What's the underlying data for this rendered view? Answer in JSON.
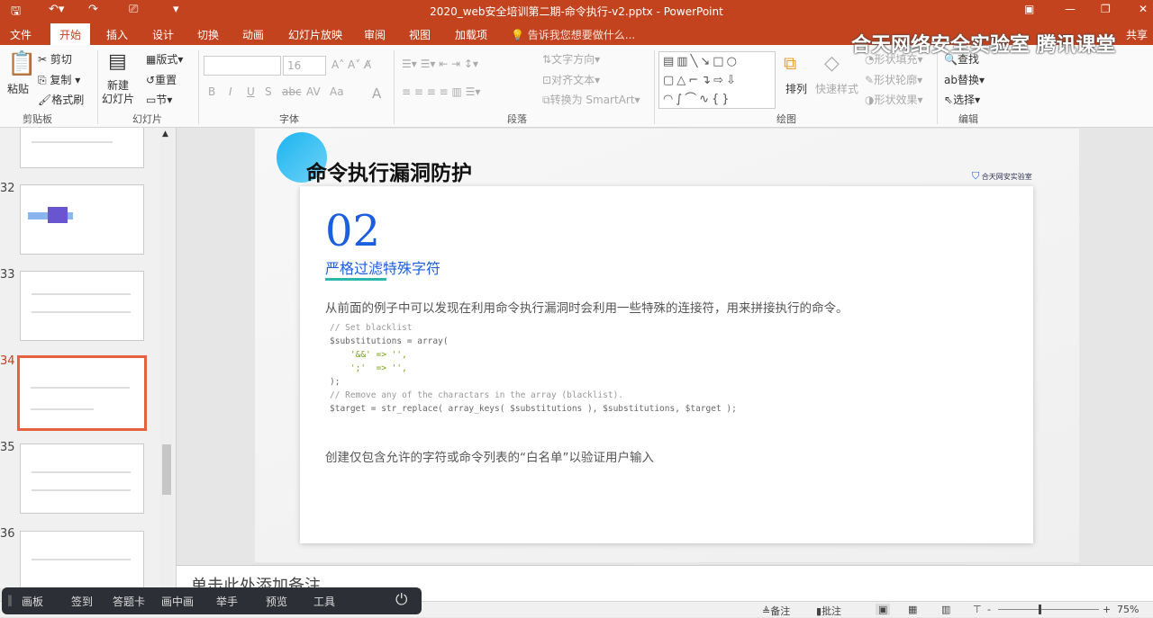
{
  "titlebar": {
    "title": "2020_web安全培训第二期-命令执行-v2.pptx - PowerPoint"
  },
  "tabs": [
    "文件",
    "开始",
    "插入",
    "设计",
    "切换",
    "动画",
    "幻灯片放映",
    "审阅",
    "视图",
    "加载项"
  ],
  "tell_me": "告诉我您想要做什么...",
  "share": "共享",
  "watermark": "合天网络安全实验室 腾讯课堂",
  "ribbon": {
    "clipboard": {
      "paste": "粘贴",
      "cut": "剪切",
      "copy": "复制",
      "format_painter": "格式刷",
      "group": "剪贴板"
    },
    "slides": {
      "new_slide": "新建\n幻灯片",
      "layout": "版式",
      "reset": "重置",
      "section": "节",
      "group": "幻灯片"
    },
    "font": {
      "size": "16",
      "group": "字体",
      "buttons": [
        "B",
        "I",
        "U",
        "S",
        "abc",
        "AV",
        "Aa",
        "A"
      ]
    },
    "paragraph": {
      "text_direction": "文字方向",
      "align_text": "对齐文本",
      "smartart": "转换为 SmartArt",
      "group": "段落"
    },
    "drawing": {
      "arrange": "排列",
      "quick_styles": "快速样式",
      "fill": "形状填充",
      "outline": "形状轮廓",
      "effects": "形状效果",
      "group": "绘图"
    },
    "editing": {
      "find": "查找",
      "replace": "替换",
      "select": "选择",
      "group": "编辑"
    }
  },
  "thumbnails": [
    {
      "num": "32"
    },
    {
      "num": "33"
    },
    {
      "num": "34"
    },
    {
      "num": "35"
    },
    {
      "num": "36"
    }
  ],
  "slide": {
    "title": "命令执行漏洞防护",
    "logo": "合天网安实验室",
    "number": "02",
    "subtitle": "严格过滤特殊字符",
    "para1": "从前面的例子中可以发现在利用命令执行漏洞时会利用一些特殊的连接符，用来拼接执行的命令。",
    "code": [
      "// Set blacklist",
      "$substitutions = array(",
      "    '&&' => '',",
      "    ';'  => '',",
      ");",
      "",
      "// Remove any of the charactars in the array (blacklist).",
      "$target = str_replace( array_keys( $substitutions ), $substitutions, $target );"
    ],
    "para2": "创建仅包含允许的字符或命令列表的“白名单”以验证用户输入"
  },
  "notes": "单击此处添加备注",
  "float_toolbar": [
    "画板",
    "签到",
    "答题卡",
    "画中画",
    "举手",
    "预览",
    "工具"
  ],
  "status": {
    "notes": "备注",
    "comments": "批注",
    "zoom": "75%"
  }
}
